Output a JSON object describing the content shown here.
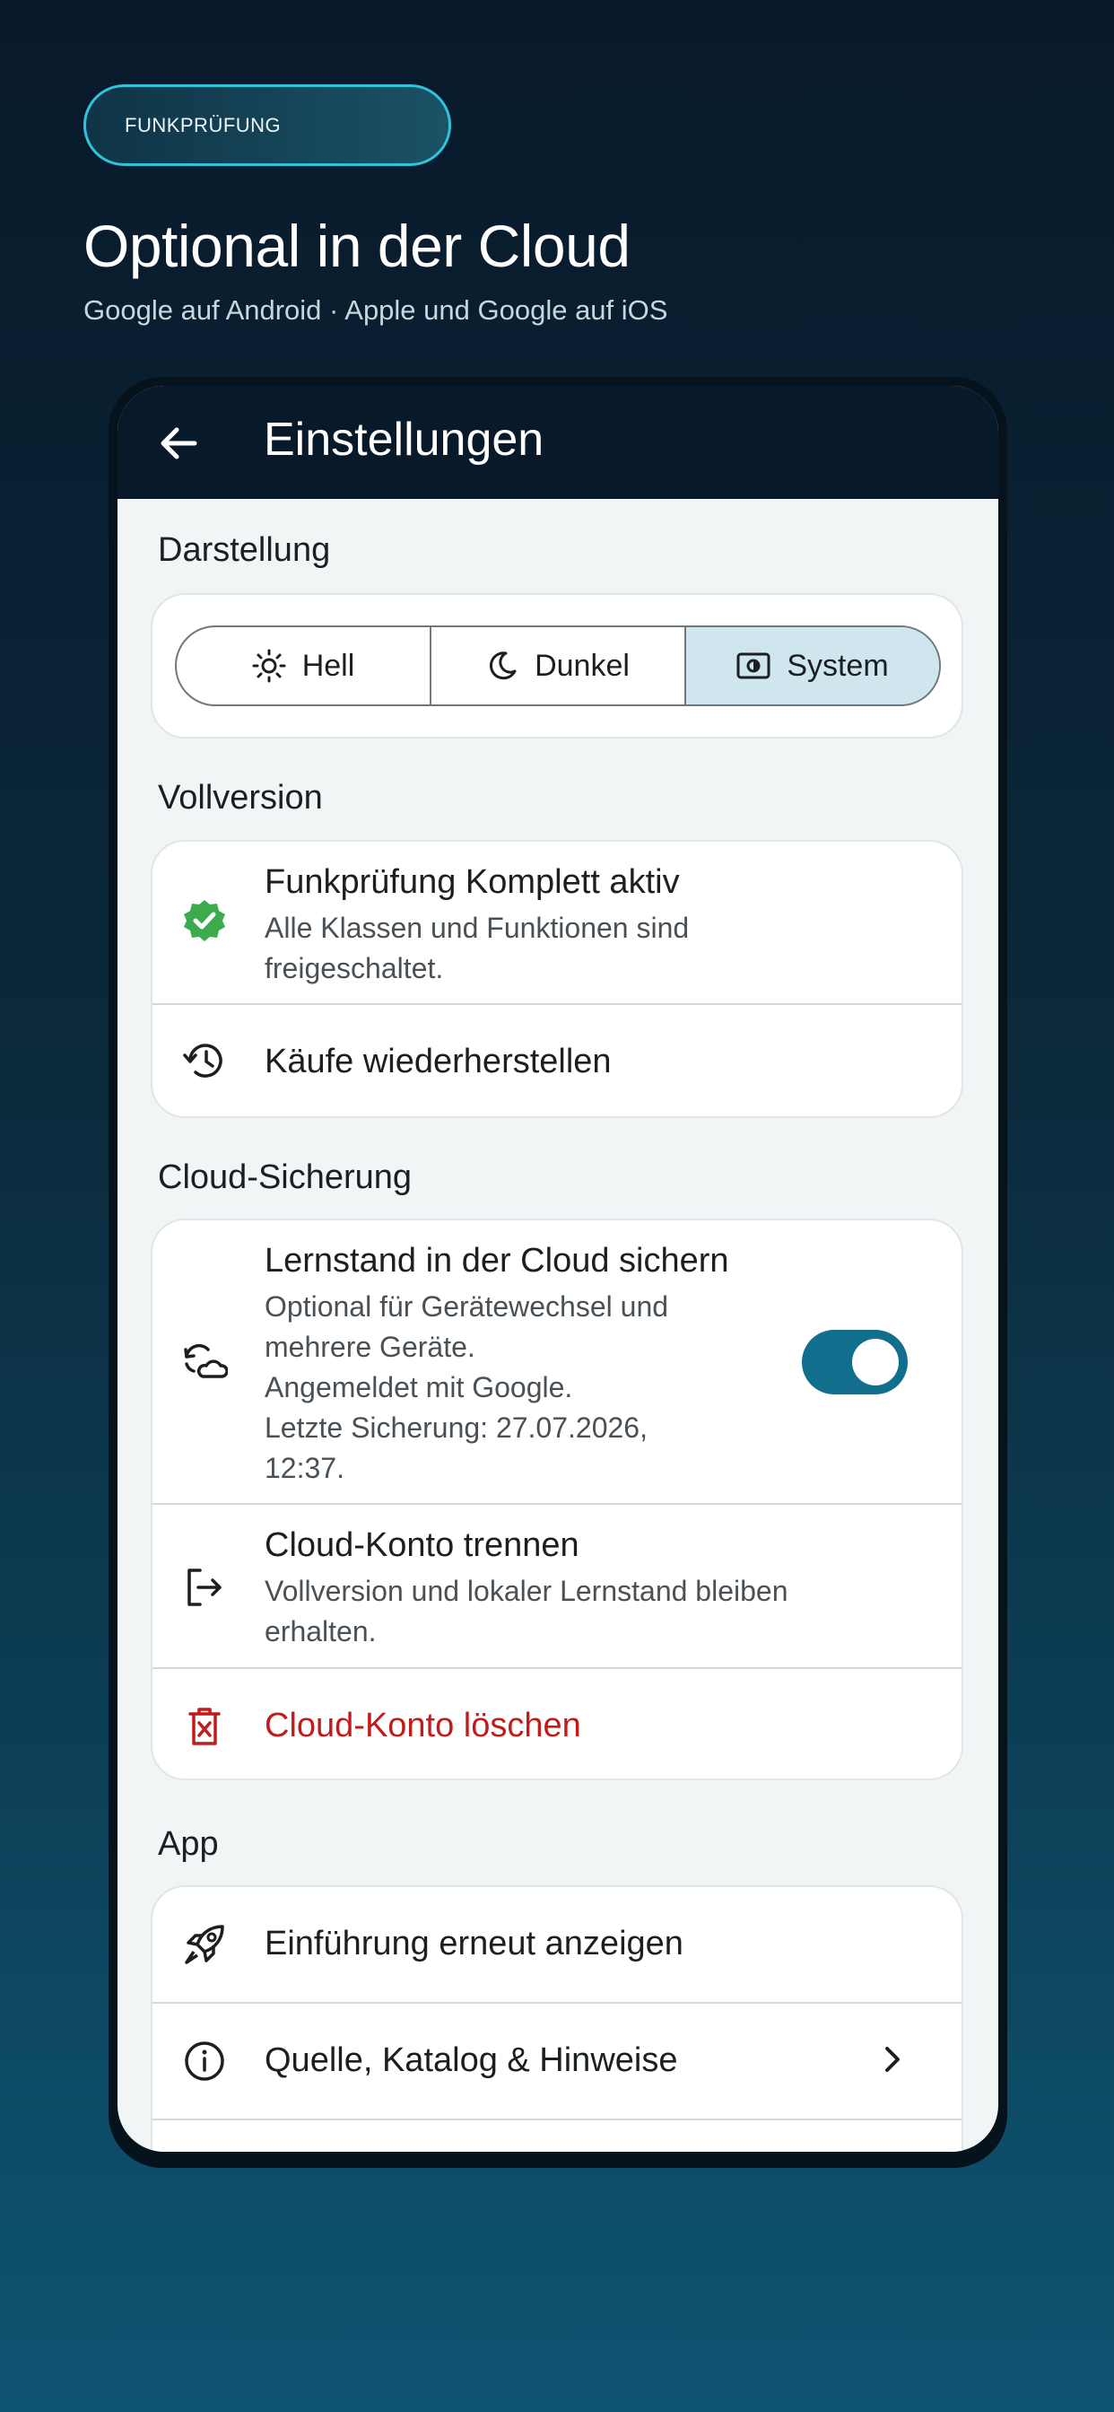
{
  "badge": "FUNKPRÜFUNG",
  "headline": "Optional in der Cloud",
  "subline": "Google auf Android · Apple und Google auf iOS",
  "appbar": {
    "title": "Einstellungen",
    "back_icon": "arrow-left-icon"
  },
  "sections": {
    "appearance": {
      "label": "Darstellung",
      "options": [
        {
          "label": "Hell",
          "icon": "sun-icon"
        },
        {
          "label": "Dunkel",
          "icon": "moon-icon"
        },
        {
          "label": "System",
          "icon": "system-theme-icon",
          "selected": true
        }
      ]
    },
    "full_version": {
      "label": "Vollversion",
      "status_title": "Funkprüfung Komplett aktiv",
      "status_sub_1": "Alle Klassen und Funktionen sind",
      "status_sub_2": "freigeschaltet.",
      "restore": "Käufe wiederherstellen"
    },
    "cloud": {
      "label": "Cloud-Sicherung",
      "backup_title": "Lernstand in der Cloud sichern",
      "backup_lines": [
        "Optional für Gerätewechsel und",
        "mehrere Geräte.",
        "Angemeldet mit Google.",
        "Letzte Sicherung: 27.07.2026,",
        "12:37."
      ],
      "backup_enabled": true,
      "disconnect_title": "Cloud-Konto trennen",
      "disconnect_sub_1": "Vollversion und lokaler Lernstand bleiben",
      "disconnect_sub_2": "erhalten.",
      "delete": "Cloud-Konto löschen"
    },
    "app": {
      "label": "App",
      "intro": "Einführung erneut anzeigen",
      "sources": "Quelle, Katalog & Hinweise"
    }
  },
  "colors": {
    "accent": "#116e8c",
    "success": "#3bab4e",
    "danger": "#c21b1b",
    "badge_border": "#2fc3dc"
  }
}
